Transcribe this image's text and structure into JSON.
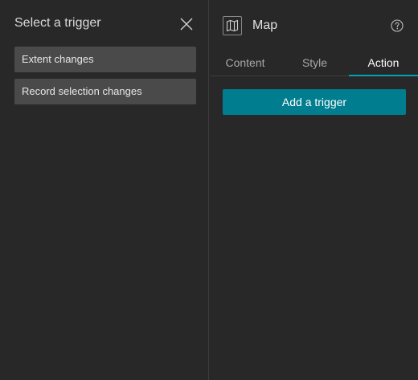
{
  "left_panel": {
    "title": "Select a trigger",
    "close_icon": "close-icon",
    "options": [
      {
        "label": "Extent changes"
      },
      {
        "label": "Record selection changes"
      }
    ]
  },
  "right_panel": {
    "widget_icon": "map-icon",
    "widget_title": "Map",
    "help_icon": "help-icon",
    "tabs": [
      {
        "label": "Content",
        "active": false
      },
      {
        "label": "Style",
        "active": false
      },
      {
        "label": "Action",
        "active": true
      }
    ],
    "add_trigger_label": "Add a trigger"
  },
  "colors": {
    "background": "#282828",
    "option_background": "#4a4a4a",
    "accent": "#007d8f",
    "tab_indicator": "#00a0b8"
  }
}
